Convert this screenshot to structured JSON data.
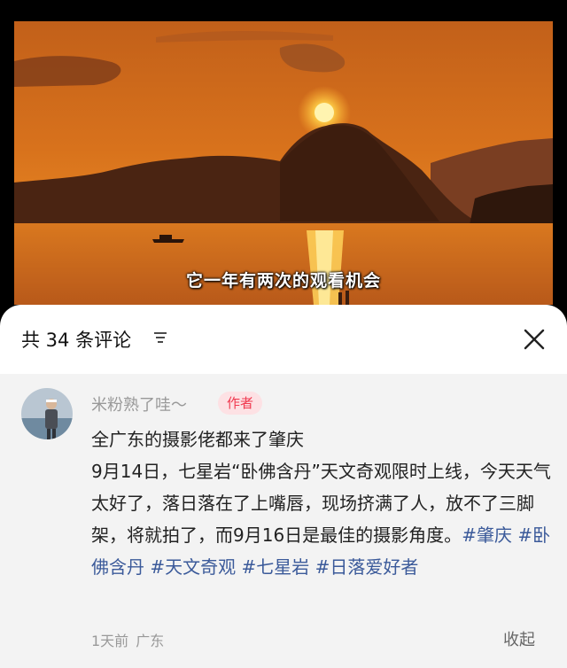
{
  "video": {
    "subtitle": "它一年有两次的观看机会"
  },
  "comments_panel": {
    "title": "共 34 条评论",
    "filter_icon": "filter-lines-icon",
    "close_icon": "close-x-icon"
  },
  "comment": {
    "username": "米粉熟了哇～",
    "badge": "作者",
    "lines": {
      "line1": "全广东的摄影佬都来了肇庆",
      "line2": "9月14日，七星岩“卧佛含丹”天文奇观限时上线，今天天气太好了，落日落在了上嘴唇，现场挤满了人，放不了三脚架，将就拍了，而9月16日是最佳的摄影角度。"
    },
    "tags": [
      "#肇庆",
      "#卧佛含丹",
      "#天文奇观",
      "#七星岩",
      "#日落爱好者"
    ],
    "time": "1天前",
    "location": "广东",
    "collapse_label": "收起"
  },
  "colors": {
    "tag": "#3b5a9a",
    "badge_text": "#f0394f",
    "badge_bg": "#fde1e4",
    "comment_bg": "#f3f3f3"
  }
}
